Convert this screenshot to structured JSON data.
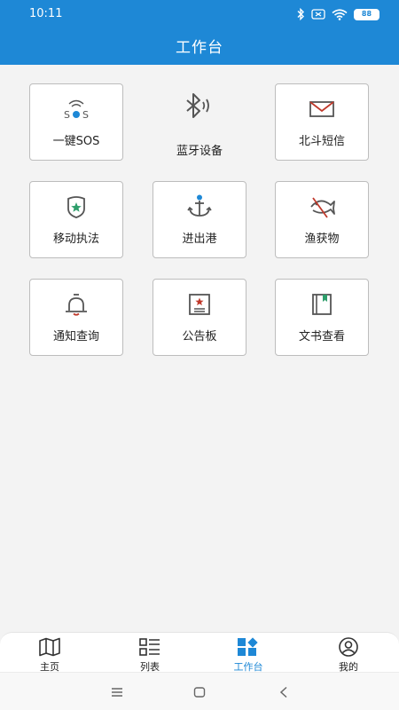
{
  "status": {
    "time": "10:11",
    "battery": "88"
  },
  "header": {
    "title": "工作台"
  },
  "tiles": [
    {
      "label": "一键SOS",
      "icon": "sos-wifi-icon"
    },
    {
      "label": "蓝牙设备",
      "icon": "bluetooth-icon"
    },
    {
      "label": "北斗短信",
      "icon": "envelope-icon"
    },
    {
      "label": "移动执法",
      "icon": "police-badge-icon"
    },
    {
      "label": "进出港",
      "icon": "anchor-icon"
    },
    {
      "label": "渔获物",
      "icon": "fish-icon"
    },
    {
      "label": "通知查询",
      "icon": "bell-icon"
    },
    {
      "label": "公告板",
      "icon": "notice-board-icon"
    },
    {
      "label": "文书查看",
      "icon": "document-book-icon"
    }
  ],
  "icon_text": {
    "sos": "SOS"
  },
  "nav": {
    "items": [
      {
        "label": "主页",
        "icon": "map-icon"
      },
      {
        "label": "列表",
        "icon": "list-icon"
      },
      {
        "label": "工作台",
        "icon": "workbench-icon"
      },
      {
        "label": "我的",
        "icon": "profile-icon"
      }
    ],
    "active_index": 2
  },
  "colors": {
    "primary": "#1e88d6",
    "icon_red": "#c0392b",
    "icon_green": "#2e9e6b",
    "icon_gray": "#555555"
  }
}
